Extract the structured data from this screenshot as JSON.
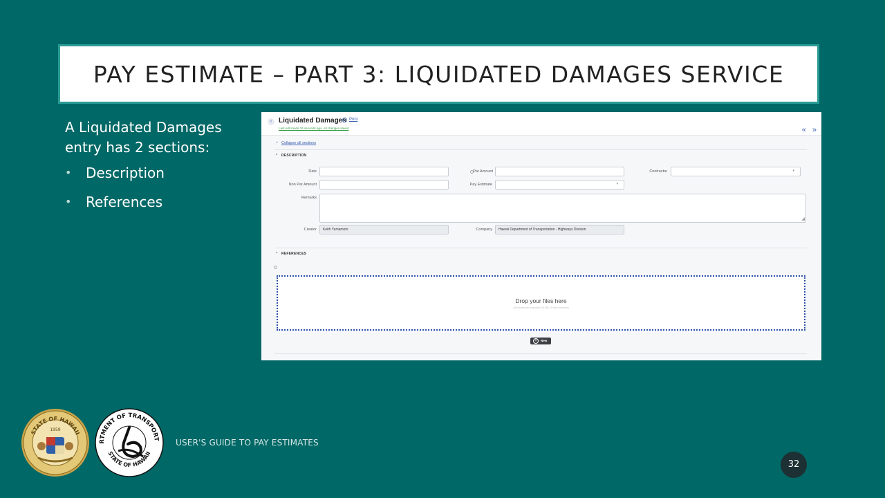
{
  "slide": {
    "title": "PAY ESTIMATE – PART 3: LIQUIDATED DAMAGES SERVICE",
    "intro": "A Liquidated Damages entry has 2 sections:",
    "bullets": [
      "Description",
      "References"
    ],
    "footer": "USER'S GUIDE TO PAY ESTIMATES",
    "page_number": "32",
    "colors": {
      "background": "#006866",
      "title_border": "#2a9c97",
      "link": "#3a5fb0"
    }
  },
  "app": {
    "title": "Liquidated Damages",
    "print_label": "Print",
    "saved_note": "Last edit made 24 seconds ago. All changes saved",
    "nav_arrows": "« »",
    "collapse_label": "Collapse all sections",
    "description_section": {
      "header": "DESCRIPTION",
      "fields": {
        "date_label": "Date",
        "date_value": "",
        "par_amount_label": "Par Amount",
        "par_amount_value": "",
        "contractor_label": "Contractor",
        "contractor_value": "",
        "non_par_amount_label": "Non Par Amount",
        "non_par_amount_value": "",
        "pay_estimate_label": "Pay Estimate",
        "pay_estimate_value": "",
        "remarks_label": "Remarks",
        "remarks_value": "",
        "creator_label": "Creator",
        "creator_value": "Keith Yamamoto",
        "company_label": "Company",
        "company_value": "Hawaii Department of Transportation - Highways Division"
      }
    },
    "references_section": {
      "header": "REFERENCES",
      "drop_text": "Drop your files here",
      "drop_subtext": "All formats are supported. 50 MB, 20 files maximum",
      "new_button": "New"
    }
  },
  "logos": {
    "state_seal_text": "STATE OF HAWAII",
    "state_seal_year": "1959",
    "dot_seal_top_text": "DEPARTMENT OF TRANSPORTATION",
    "dot_seal_bottom_text": "STATE OF HAWAII"
  }
}
